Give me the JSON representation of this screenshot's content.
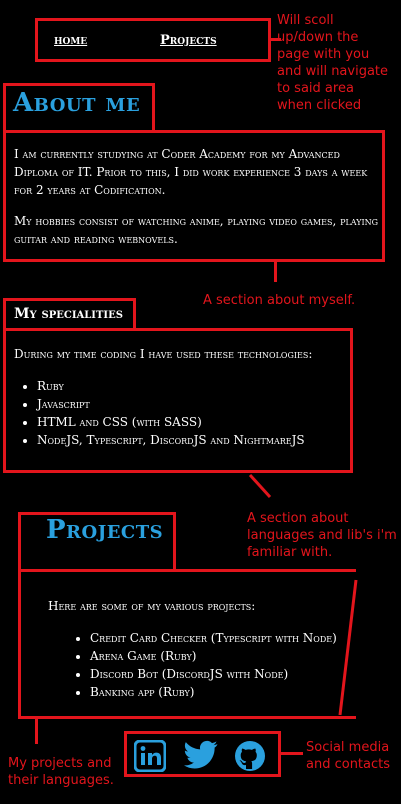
{
  "nav": {
    "home": "home",
    "projects": "Projects"
  },
  "notes": {
    "nav": "Will scoll up/down the page with you and will navigate to said area when clicked",
    "about": "A section about myself.",
    "specialities": "A section about languages and lib's i'm familiar with.",
    "projects": "My projects and their languages.",
    "social": "Social media and contacts"
  },
  "about": {
    "title": "About me",
    "p1": "I am currently studying at Coder Academy for my Advanced Diploma of IT. Prior to this, I did work experience 3 days a week for 2 years at Codification.",
    "p2": "My hobbies consist of watching anime, playing video games, playing guitar and reading webnovels."
  },
  "specialities": {
    "title": "My specialities",
    "intro": "During my time coding I have used these technologies:",
    "items": [
      "Ruby",
      "Javascript",
      "HTML and CSS (with SASS)",
      "NodeJS, Typescript, DiscordJS and NightmareJS"
    ]
  },
  "projects": {
    "title": "Projects",
    "intro": "Here are some of my various projects:",
    "items": [
      {
        "link": "Credit Card Checker",
        "lang": " (Typescript with Node)"
      },
      {
        "link": "Arena Game",
        "lang": " (Ruby)"
      },
      {
        "link": "Discord Bot",
        "lang": " (DiscordJS with Node)"
      },
      {
        "link": "Banking app",
        "lang": " (Ruby)"
      }
    ]
  },
  "social": {
    "icons": [
      "linkedin-icon",
      "twitter-icon",
      "github-icon"
    ],
    "accent": "#2aa0de"
  },
  "colors": {
    "annotation": "#e3151c",
    "heading": "#2aa0de",
    "background": "#000000"
  }
}
